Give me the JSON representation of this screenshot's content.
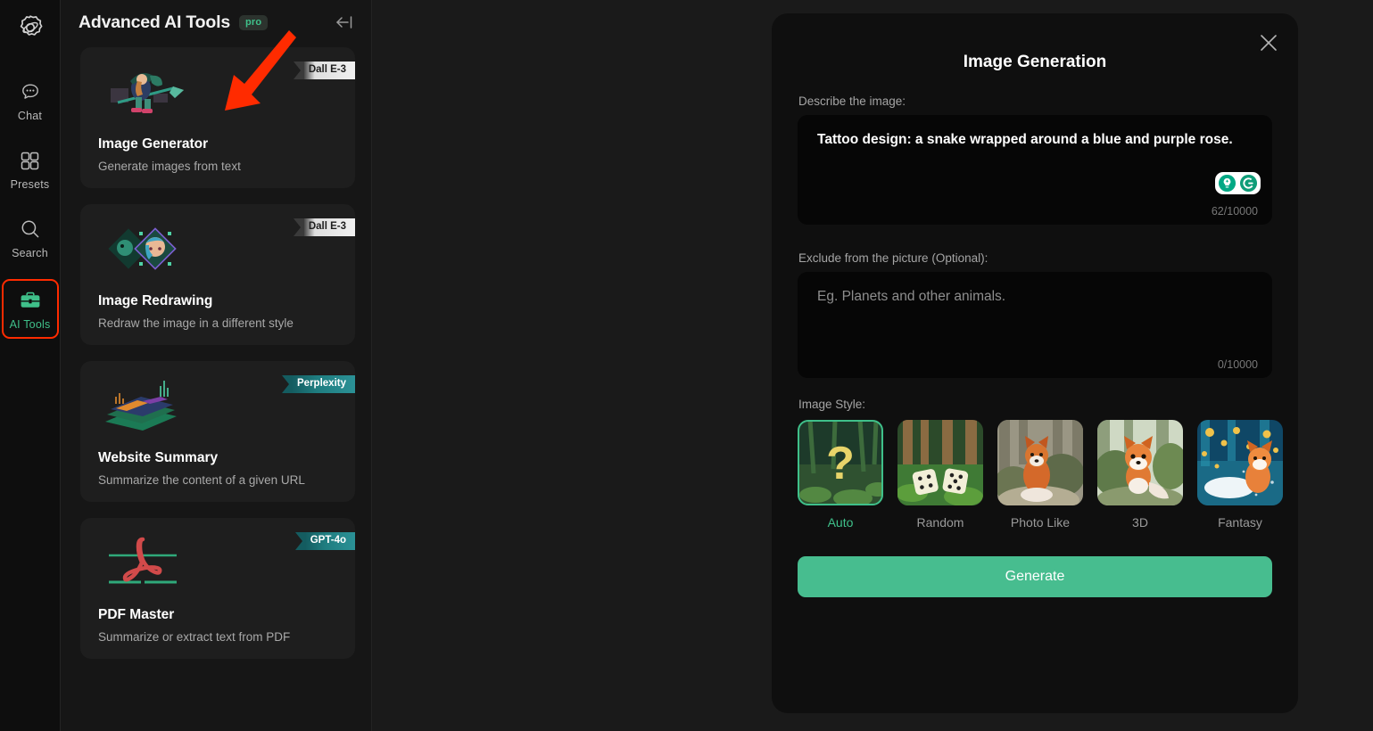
{
  "rail": {
    "logo_icon": "app-logo-icon",
    "items": [
      {
        "label": "Chat",
        "icon": "chat-bubble-icon",
        "active": false
      },
      {
        "label": "Presets",
        "icon": "grid-squares-icon",
        "active": false
      },
      {
        "label": "Search",
        "icon": "magnifier-icon",
        "active": false
      },
      {
        "label": "AI Tools",
        "icon": "toolbox-icon",
        "active": true
      }
    ]
  },
  "panel": {
    "title": "Advanced AI Tools",
    "pro_badge": "pro",
    "collapse_icon": "collapse-panel-icon",
    "cards": [
      {
        "title": "Image Generator",
        "desc": "Generate images from text",
        "badge": "Dall E-3",
        "badge_style": "light",
        "thumb_icon": "pixel-witch-on-broom-icon"
      },
      {
        "title": "Image Redrawing",
        "desc": "Redraw the image in a different style",
        "badge": "Dall E-3",
        "badge_style": "light",
        "thumb_icon": "pixel-portrait-transform-icon"
      },
      {
        "title": "Website Summary",
        "desc": "Summarize the content of a given URL",
        "badge": "Perplexity",
        "badge_style": "teal",
        "thumb_icon": "data-layers-chart-icon"
      },
      {
        "title": "PDF Master",
        "desc": "Summarize or extract text from PDF",
        "badge": "GPT-4o",
        "badge_style": "teal",
        "thumb_icon": "pdf-document-icon"
      }
    ]
  },
  "modal": {
    "title": "Image Generation",
    "close_icon": "close-icon",
    "prompt": {
      "label": "Describe the image:",
      "value": "Tattoo design: a snake wrapped around a blue and purple rose.",
      "counter": "62/10000",
      "assist_icons": [
        "idea-lightbulb-icon",
        "grammarly-g-icon"
      ]
    },
    "exclude": {
      "label": "Exclude from the picture (Optional):",
      "value": "",
      "placeholder": "Eg. Planets and other animals.",
      "counter": "0/10000"
    },
    "style": {
      "label": "Image Style:",
      "selected": "Auto",
      "options": [
        {
          "name": "Auto",
          "thumb": "question-mark-forest-thumb"
        },
        {
          "name": "Random",
          "thumb": "dice-forest-thumb"
        },
        {
          "name": "Photo Like",
          "thumb": "photo-fox-thumb"
        },
        {
          "name": "3D",
          "thumb": "3d-fox-thumb"
        },
        {
          "name": "Fantasy",
          "thumb": "fantasy-fox-thumb"
        }
      ]
    },
    "generate_label": "Generate"
  },
  "annotations": {
    "arrow_color": "#ff2b00",
    "arrows": [
      {
        "name": "arrow-pointing-image-generator-card"
      },
      {
        "name": "arrow-pointing-generate-button"
      }
    ],
    "highlight_box_color": "#ff2b00"
  },
  "colors": {
    "accent_green": "#3fc08a",
    "button_green": "#47bd8f",
    "page_bg": "#1a1a1a",
    "panel_bg": "#161616",
    "card_bg": "#1e1e1e",
    "modal_bg": "#0f0f0f",
    "input_bg": "#060606"
  }
}
